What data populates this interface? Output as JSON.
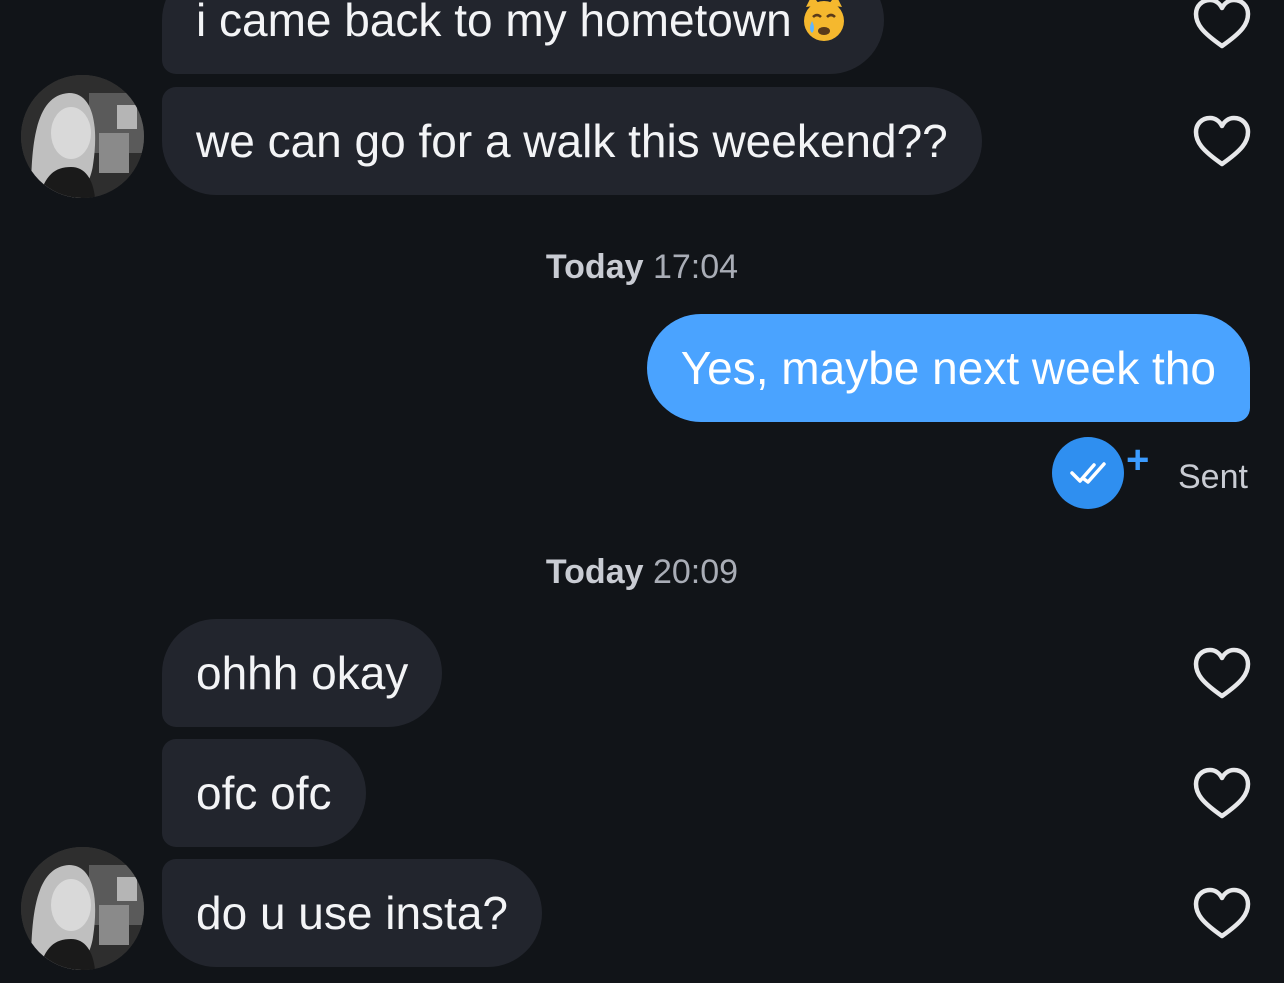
{
  "messages": {
    "m1": "i came back to my hometown",
    "m2": "we can go for a walk this weekend??",
    "m3": "Yes, maybe next week tho",
    "m4": "ohhh okay",
    "m5": "ofc ofc",
    "m6": "do u use insta?"
  },
  "timestamps": [
    {
      "day": "Today",
      "time": "17:04"
    },
    {
      "day": "Today",
      "time": "20:09"
    }
  ],
  "status": {
    "sent_label": "Sent",
    "plus": "+"
  },
  "colors": {
    "background": "#111418",
    "received_bubble": "#22252d",
    "sent_bubble": "#4aa3ff",
    "accent": "#2f8ff0"
  },
  "icons": {
    "like": "heart-outline-icon",
    "emoji": "crying-cat-face-emoji",
    "receipt": "double-check-read-icon"
  }
}
